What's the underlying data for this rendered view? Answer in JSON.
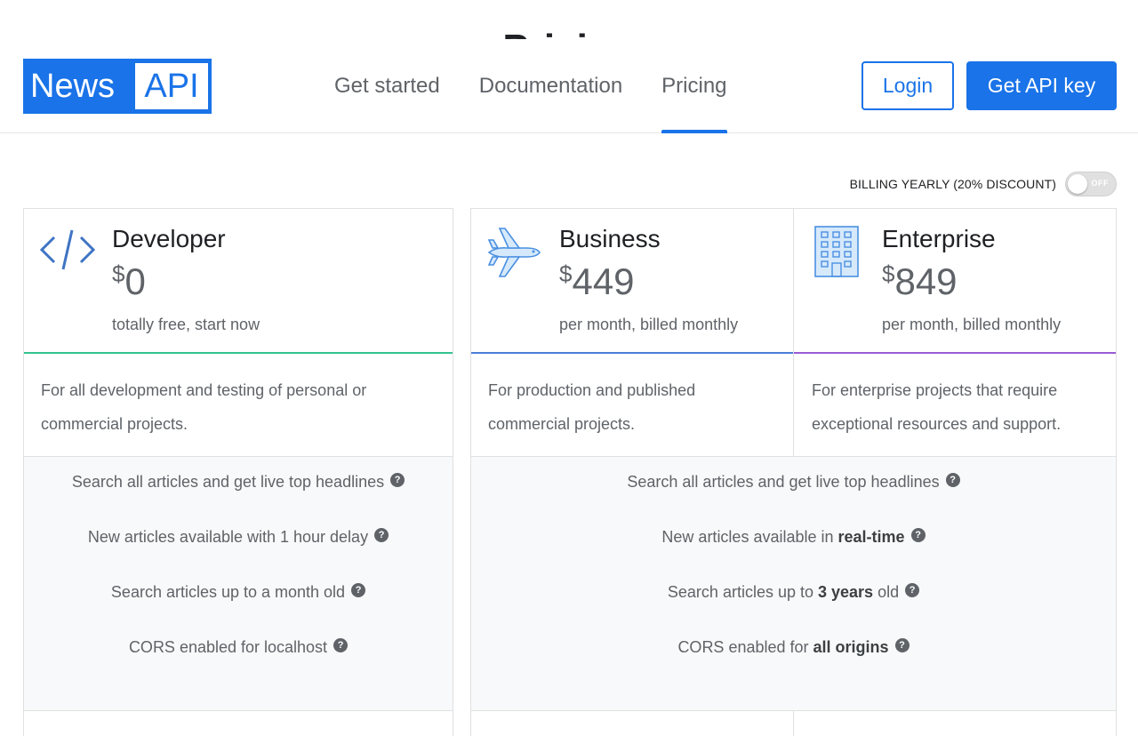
{
  "page_title_partial": "Pricing",
  "logo": {
    "part1": "News",
    "part2": "API"
  },
  "nav": [
    {
      "label": "Get started"
    },
    {
      "label": "Documentation"
    },
    {
      "label": "Pricing"
    }
  ],
  "header_buttons": {
    "login": "Login",
    "get_key": "Get API key"
  },
  "billing": {
    "label": "BILLING YEARLY (20% DISCOUNT)",
    "toggle_state": "OFF"
  },
  "plans": [
    {
      "name": "Developer",
      "currency": "$",
      "price": "0",
      "subtitle": "totally free, start now",
      "description": [
        "For all development and testing of personal or",
        "commercial projects."
      ],
      "accent": "#34c38f",
      "icon": "code-icon"
    },
    {
      "name": "Business",
      "currency": "$",
      "price": "449",
      "subtitle": "per month, billed monthly",
      "description": [
        "For production and published",
        "commercial projects."
      ],
      "accent": "#4a7fd6",
      "icon": "airplane-icon"
    },
    {
      "name": "Enterprise",
      "currency": "$",
      "price": "849",
      "subtitle": "per month, billed monthly",
      "description": [
        "For enterprise projects that require",
        "exceptional resources and support."
      ],
      "accent": "#9a5bd6",
      "icon": "building-icon"
    }
  ],
  "features_dev": [
    {
      "text": "Search all articles and get live top headlines"
    },
    {
      "text": "New articles available with 1 hour delay"
    },
    {
      "text": "Search articles up to a month old"
    },
    {
      "text": "CORS enabled for localhost"
    }
  ],
  "features_paid": [
    {
      "pre": "Search all articles and get live top headlines",
      "bold": "",
      "post": ""
    },
    {
      "pre": "New articles available in ",
      "bold": "real-time",
      "post": ""
    },
    {
      "pre": "Search articles up to ",
      "bold": "3 years",
      "post": " old"
    },
    {
      "pre": "CORS enabled for ",
      "bold": "all origins",
      "post": ""
    }
  ],
  "help_glyph": "?",
  "colors": {
    "brand": "#1a73e8"
  }
}
